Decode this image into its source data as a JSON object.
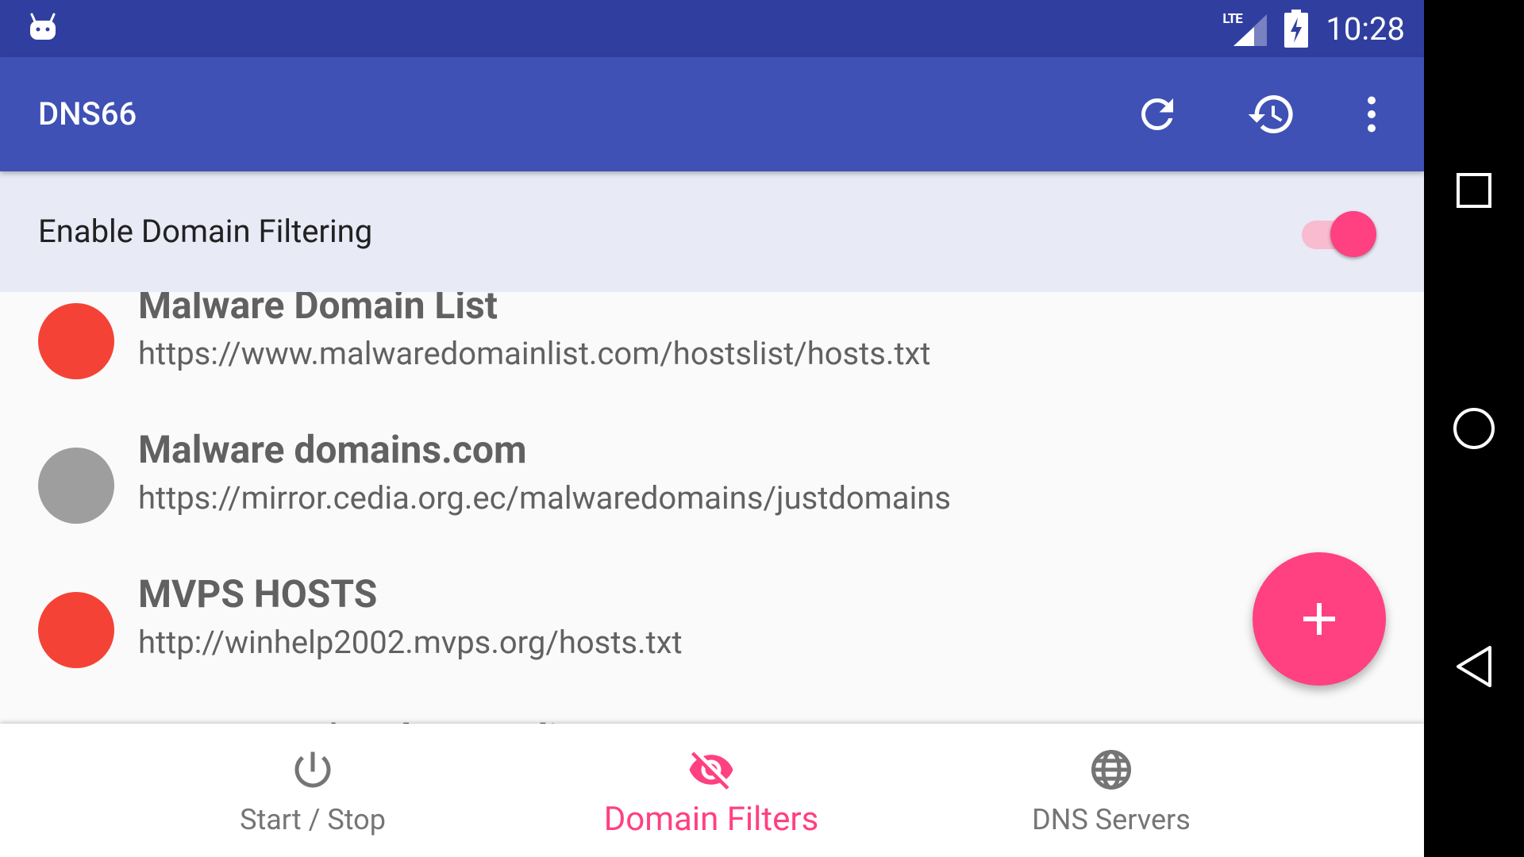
{
  "status_bar": {
    "network": "LTE",
    "time": "10:28"
  },
  "app_bar": {
    "title": "DNS66",
    "actions": [
      "refresh-icon",
      "history-icon",
      "more-vert-icon"
    ]
  },
  "filter_toggle": {
    "label": "Enable Domain Filtering",
    "enabled": true
  },
  "hosts_list": [
    {
      "title": "Malware Domain List",
      "url": "https://www.malwaredomainlist.com/hostslist/hosts.txt",
      "status_color": "#f44336"
    },
    {
      "title": "Malware domains.com",
      "url": "https://mirror.cedia.org.ec/malwaredomains/justdomains",
      "status_color": "#9e9e9e"
    },
    {
      "title": "MVPS HOSTS",
      "url": "http://winhelp2002.mvps.org/hosts.txt",
      "status_color": "#f44336"
    },
    {
      "title": "Peter Lowe's Ad server list",
      "url": "",
      "status_color": "#f44336"
    }
  ],
  "fab": {
    "icon": "add-icon"
  },
  "bottom_nav": {
    "items": [
      {
        "label": "Start / Stop",
        "icon": "power-icon",
        "active": false
      },
      {
        "label": "Domain Filters",
        "icon": "visibility-off-icon",
        "active": true
      },
      {
        "label": "DNS Servers",
        "icon": "globe-icon",
        "active": false
      }
    ]
  },
  "system_nav": [
    "recents-icon",
    "home-icon",
    "back-icon"
  ],
  "colors": {
    "primary": "#3f51b5",
    "primary_dark": "#303f9f",
    "accent": "#ff4081",
    "header_tint": "#e8eaf6"
  }
}
